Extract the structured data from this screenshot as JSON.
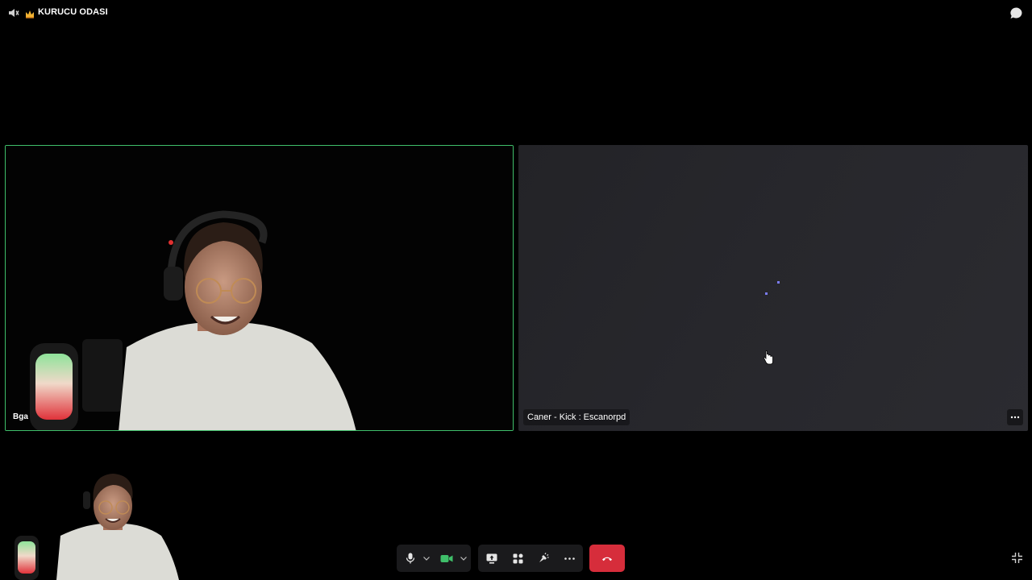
{
  "header": {
    "room_title": "KURUCU ODASI"
  },
  "participants": [
    {
      "name": "Bga",
      "speaking": true,
      "video": "on"
    },
    {
      "name": "Caner - Kick : Escanorpd",
      "video": "loading"
    }
  ],
  "colors": {
    "speaking_border": "#3fbf6a",
    "camera_on": "#3fbf6a",
    "hangup": "#d62d3b",
    "loader": "#7a7cf0"
  },
  "icons": {
    "header": [
      "speaker-muted-icon",
      "crown-icon",
      "chat-icon"
    ],
    "controls": [
      "microphone-icon",
      "chevron-down-icon",
      "camera-icon",
      "chevron-down-icon",
      "screen-share-icon",
      "activities-icon",
      "soundboard-icon",
      "more-icon",
      "hang-up-icon"
    ],
    "window": [
      "minimize-icon"
    ]
  }
}
